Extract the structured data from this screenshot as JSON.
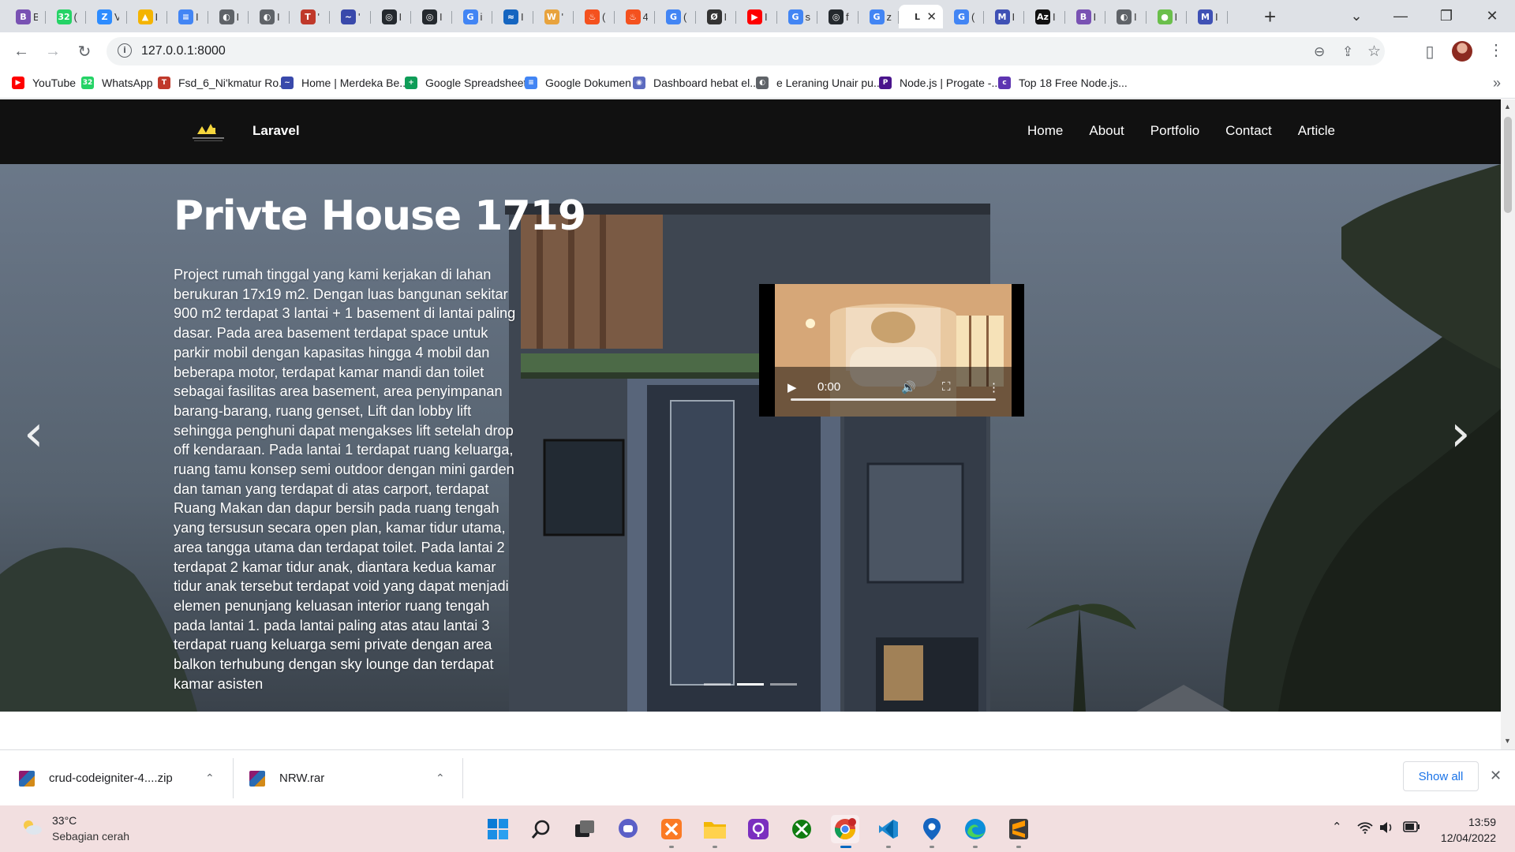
{
  "browser": {
    "tabs": [
      {
        "icon": "B",
        "color": "#7952b3",
        "title": "B"
      },
      {
        "icon": "32",
        "color": "#25d366",
        "title": "("
      },
      {
        "icon": "Z",
        "color": "#2d8cff",
        "title": "V"
      },
      {
        "icon": "▲",
        "color": "#f4b400",
        "title": "I"
      },
      {
        "icon": "≡",
        "color": "#4285f4",
        "title": "I"
      },
      {
        "icon": "◐",
        "color": "#5f6368",
        "title": "I"
      },
      {
        "icon": "◐",
        "color": "#5f6368",
        "title": "I"
      },
      {
        "icon": "T",
        "color": "#c0392b",
        "title": "'"
      },
      {
        "icon": "~",
        "color": "#3949ab",
        "title": "'"
      },
      {
        "icon": "◎",
        "color": "#24292e",
        "title": "I"
      },
      {
        "icon": "◎",
        "color": "#24292e",
        "title": "I"
      },
      {
        "icon": "G",
        "color": "#4285f4",
        "title": "i"
      },
      {
        "icon": "≈",
        "color": "#1565c0",
        "title": "I"
      },
      {
        "icon": "W",
        "color": "#e8a33d",
        "title": "'"
      },
      {
        "icon": "♨",
        "color": "#f4511e",
        "title": "("
      },
      {
        "icon": "♨",
        "color": "#f4511e",
        "title": "4"
      },
      {
        "icon": "G",
        "color": "#4285f4",
        "title": "("
      },
      {
        "icon": "Ø",
        "color": "#333333",
        "title": "I"
      },
      {
        "icon": "▶",
        "color": "#ff0000",
        "title": "I"
      },
      {
        "icon": "G",
        "color": "#4285f4",
        "title": "s"
      },
      {
        "icon": "◎",
        "color": "#24292e",
        "title": "f"
      },
      {
        "icon": "G",
        "color": "#4285f4",
        "title": "z"
      },
      {
        "icon": "L",
        "color": "#ffffff",
        "title": "L",
        "active": true
      },
      {
        "icon": "G",
        "color": "#4285f4",
        "title": "("
      },
      {
        "icon": "M",
        "color": "#3f51b5",
        "title": "I"
      },
      {
        "icon": "Az",
        "color": "#111111",
        "title": "I"
      },
      {
        "icon": "B",
        "color": "#7952b3",
        "title": "I"
      },
      {
        "icon": "◐",
        "color": "#5f6368",
        "title": "I"
      },
      {
        "icon": "●",
        "color": "#6abf4b",
        "title": "I"
      },
      {
        "icon": "M",
        "color": "#3f51b5",
        "title": "I"
      }
    ],
    "active_tab_close": "✕",
    "new_tab": "+",
    "window_controls": {
      "dropdown": "⌄",
      "minimize": "—",
      "maximize": "❐",
      "close": "✕"
    },
    "nav": {
      "back": "←",
      "forward": "→",
      "reload": "↻"
    },
    "address": {
      "info_icon": "i",
      "url": "127.0.0.1:8000"
    },
    "omnibox_icons": {
      "zoom": "⊖",
      "share": "⇪",
      "bookmark": "☆"
    },
    "side_panel": "▯",
    "menu": "⋮"
  },
  "bookmarks": [
    {
      "label": "YouTube",
      "icon": "▶",
      "color": "#ff0000"
    },
    {
      "label": "WhatsApp",
      "icon": "32",
      "color": "#25d366"
    },
    {
      "label": "Fsd_6_Ni'kmatur Ro...",
      "icon": "T",
      "color": "#c0392b"
    },
    {
      "label": "Home | Merdeka Be...",
      "icon": "~",
      "color": "#3949ab"
    },
    {
      "label": "Google Spreadsheet",
      "icon": "+",
      "color": "#0f9d58"
    },
    {
      "label": "Google Dokumen",
      "icon": "≡",
      "color": "#4285f4"
    },
    {
      "label": "Dashboard hebat el...",
      "icon": "◉",
      "color": "#5c6bc0"
    },
    {
      "label": "e Leraning Unair pu...",
      "icon": "◐",
      "color": "#5f6368"
    },
    {
      "label": "Node.js | Progate -...",
      "icon": "P",
      "color": "#4a148c"
    },
    {
      "label": "Top 18 Free Node.js...",
      "icon": "c",
      "color": "#5e35b1"
    }
  ],
  "bookmarks_more": "»",
  "site": {
    "brand": "Laravel",
    "menu": [
      "Home",
      "About",
      "Portfolio",
      "Contact",
      "Article"
    ]
  },
  "hero": {
    "title": "Privte House 1719",
    "description": "Project rumah tinggal yang kami kerjakan di lahan berukuran 17x19 m2. Dengan luas bangunan sekitar 900 m2 terdapat 3 lantai + 1 basement di lantai paling dasar. Pada area basement terdapat space untuk parkir mobil dengan kapasitas hingga 4 mobil dan beberapa motor, terdapat kamar mandi dan toilet sebagai fasilitas area basement, area penyimpanan barang-barang, ruang genset, Lift dan lobby lift sehingga penghuni dapat mengakses lift setelah drop off kendaraan. Pada lantai 1 terdapat ruang keluarga, ruang tamu konsep semi outdoor dengan mini garden dan taman yang terdapat di atas carport, terdapat Ruang Makan dan dapur bersih pada ruang tengah yang tersusun secara open plan, kamar tidur utama, area tangga utama dan terdapat toilet. Pada lantai 2 terdapat 2 kamar tidur anak, diantara kedua kamar tidur anak tersebut terdapat void yang dapat menjadi elemen penunjang keluasan interior ruang tengah pada lantai 1. pada lantai paling atas atau lantai 3 terdapat ruang keluarga semi private dengan area balkon terhubung dengan sky lounge dan terdapat kamar asisten",
    "prev": "‹",
    "next": "›",
    "slides": 3,
    "active_slide": 2,
    "video": {
      "play": "▶",
      "time": "0:00",
      "volume": "🔊",
      "fullscreen": "⛶",
      "more": "⋮"
    }
  },
  "downloads": [
    {
      "name": "crud-codeigniter-4....zip",
      "chevron": "⌃"
    },
    {
      "name": "NRW.rar",
      "chevron": "⌃"
    }
  ],
  "downloads_show_all": "Show all",
  "downloads_close": "✕",
  "taskbar": {
    "weather_temp": "33°C",
    "weather_desc": "Sebagian cerah",
    "apps": [
      "start",
      "search",
      "task-view",
      "teams",
      "xampp",
      "file-explorer",
      "podcasts",
      "xbox",
      "chrome",
      "vscode",
      "maps",
      "edge",
      "sublime"
    ],
    "active_app": "chrome",
    "tray": {
      "chevron": "⌃",
      "wifi": "◠",
      "volume": "🔈",
      "battery": "▭"
    },
    "time": "13:59",
    "date": "12/04/2022"
  },
  "colors": {
    "nav_bg": "#111111",
    "accent_link": "#1a73e8",
    "taskbar_bg": "#f2dfe0"
  }
}
